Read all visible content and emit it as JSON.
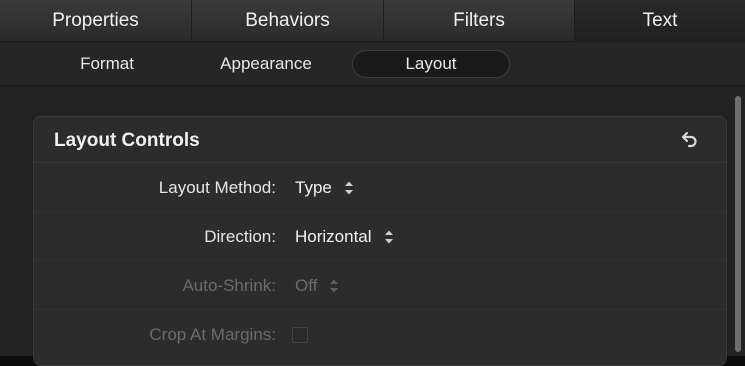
{
  "tabs": [
    {
      "label": "Properties"
    },
    {
      "label": "Behaviors"
    },
    {
      "label": "Filters"
    },
    {
      "label": "Text",
      "selected": true
    }
  ],
  "subtabs": [
    {
      "label": "Format"
    },
    {
      "label": "Appearance"
    },
    {
      "label": "Layout",
      "selected": true
    }
  ],
  "panel": {
    "title": "Layout Controls",
    "reset_icon": "reset-arrow-icon",
    "rows": [
      {
        "label": "Layout Method:",
        "value": "Type",
        "control": "popup",
        "enabled": true
      },
      {
        "label": "Direction:",
        "value": "Horizontal",
        "control": "popup",
        "enabled": true
      },
      {
        "label": "Auto-Shrink:",
        "value": "Off",
        "control": "popup",
        "enabled": false
      },
      {
        "label": "Crop At Margins:",
        "control": "checkbox",
        "checked": false,
        "enabled": false
      }
    ]
  }
}
